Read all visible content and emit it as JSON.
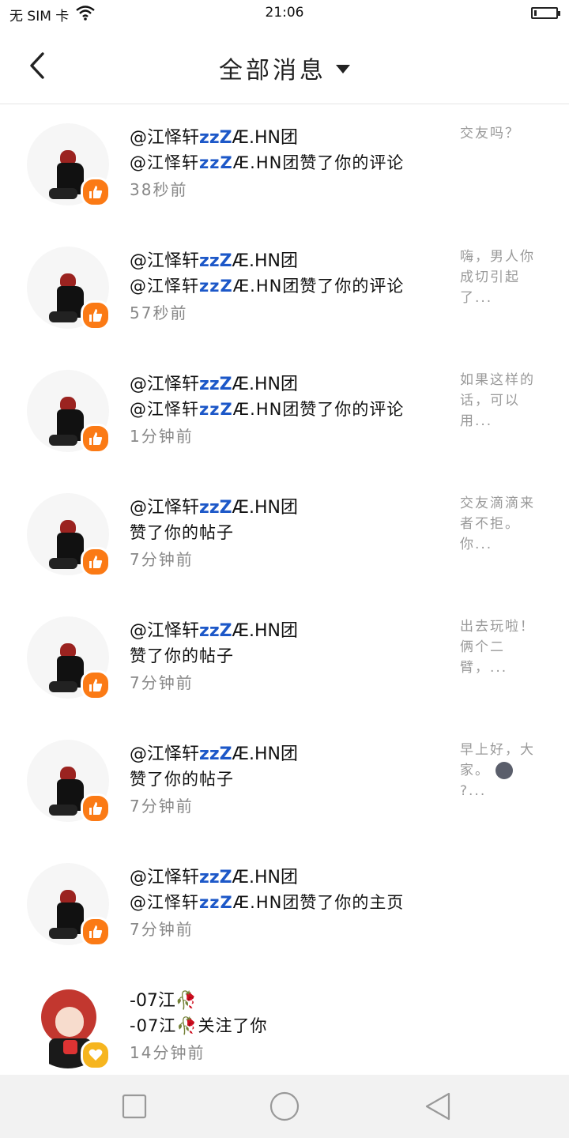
{
  "status": {
    "carrier": "无 SIM 卡",
    "time": "21:06",
    "icons": [
      "wifi-icon",
      "battery-icon"
    ]
  },
  "header": {
    "title": "全部消息",
    "back_icon": "chevron-left-icon",
    "dropdown_icon": "caret-down-icon"
  },
  "items": [
    {
      "name": "@江怿轩zzZÆ.HN团",
      "desc": "@江怿轩zzZÆ.HN团赞了你的评论",
      "time": "38秒前",
      "snippet": "交友吗？",
      "badge": "thumbs-up"
    },
    {
      "name": "@江怿轩zzZÆ.HN团",
      "desc": "@江怿轩zzZÆ.HN团赞了你的评论",
      "time": "57秒前",
      "snippet": "嗨，男人你成切引起了...",
      "badge": "thumbs-up"
    },
    {
      "name": "@江怿轩zzZÆ.HN团",
      "desc": "@江怿轩zzZÆ.HN团赞了你的评论",
      "time": "1分钟前",
      "snippet": "如果这样的话，可以用...",
      "badge": "thumbs-up"
    },
    {
      "name": "@江怿轩zzZÆ.HN团",
      "desc": "赞了你的帖子",
      "time": "7分钟前",
      "snippet": "交友滴滴来者不拒。你...",
      "badge": "thumbs-up"
    },
    {
      "name": "@江怿轩zzZÆ.HN团",
      "desc": "赞了你的帖子",
      "time": "7分钟前",
      "snippet": "出去玩啦！俩个二臂，...",
      "badge": "thumbs-up"
    },
    {
      "name": "@江怿轩zzZÆ.HN团",
      "desc": "赞了你的帖子",
      "time": "7分钟前",
      "snippet": "早上好，大家。",
      "snippet_tail": "?...",
      "badge": "thumbs-up"
    },
    {
      "name": "@江怿轩zzZÆ.HN团",
      "desc": "@江怿轩zzZÆ.HN团赞了你的主页",
      "time": "7分钟前",
      "snippet": "",
      "badge": "thumbs-up"
    },
    {
      "name": "-07江🥀",
      "desc": "-07江🥀关注了你",
      "time": "14分钟前",
      "snippet": "",
      "badge": "heart"
    }
  ],
  "nav": {
    "recent_icon": "square-icon",
    "home_icon": "circle-icon",
    "back_icon": "triangle-back-icon"
  },
  "colors": {
    "like_badge": "#fb7a15",
    "follow_badge": "#f6b51f",
    "time_text": "#888888",
    "snippet_text": "#999999"
  }
}
